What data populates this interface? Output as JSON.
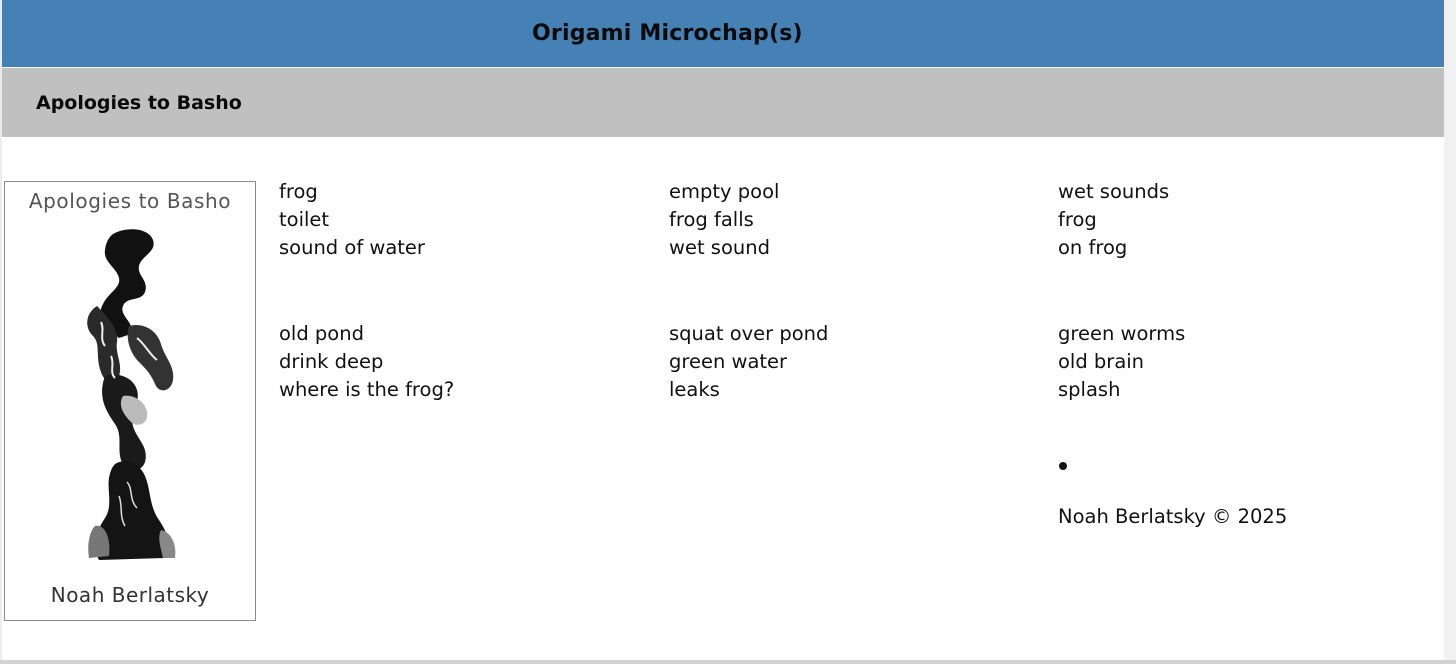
{
  "header": {
    "site_title": "Origami Microchap(s)",
    "section_title": "Apologies to Basho"
  },
  "cover": {
    "title": "Apologies to Basho",
    "author": "Noah Berlatsky"
  },
  "poems": [
    {
      "lines": [
        "frog",
        "toilet",
        "sound of water"
      ]
    },
    {
      "lines": [
        "empty pool",
        "frog falls",
        "wet sound"
      ]
    },
    {
      "lines": [
        "wet sounds",
        "frog",
        "on frog"
      ]
    },
    {
      "lines": [
        "old pond",
        "drink deep",
        "where is the frog?"
      ]
    },
    {
      "lines": [
        "squat over pond",
        "green water",
        "leaks"
      ]
    },
    {
      "lines": [
        "green worms",
        "old brain",
        "splash"
      ]
    }
  ],
  "footer": {
    "copyright": "Noah Berlatsky © 2025"
  },
  "colors": {
    "header_bar": "#4681b6",
    "subheader_bar": "#c0c0c0"
  }
}
